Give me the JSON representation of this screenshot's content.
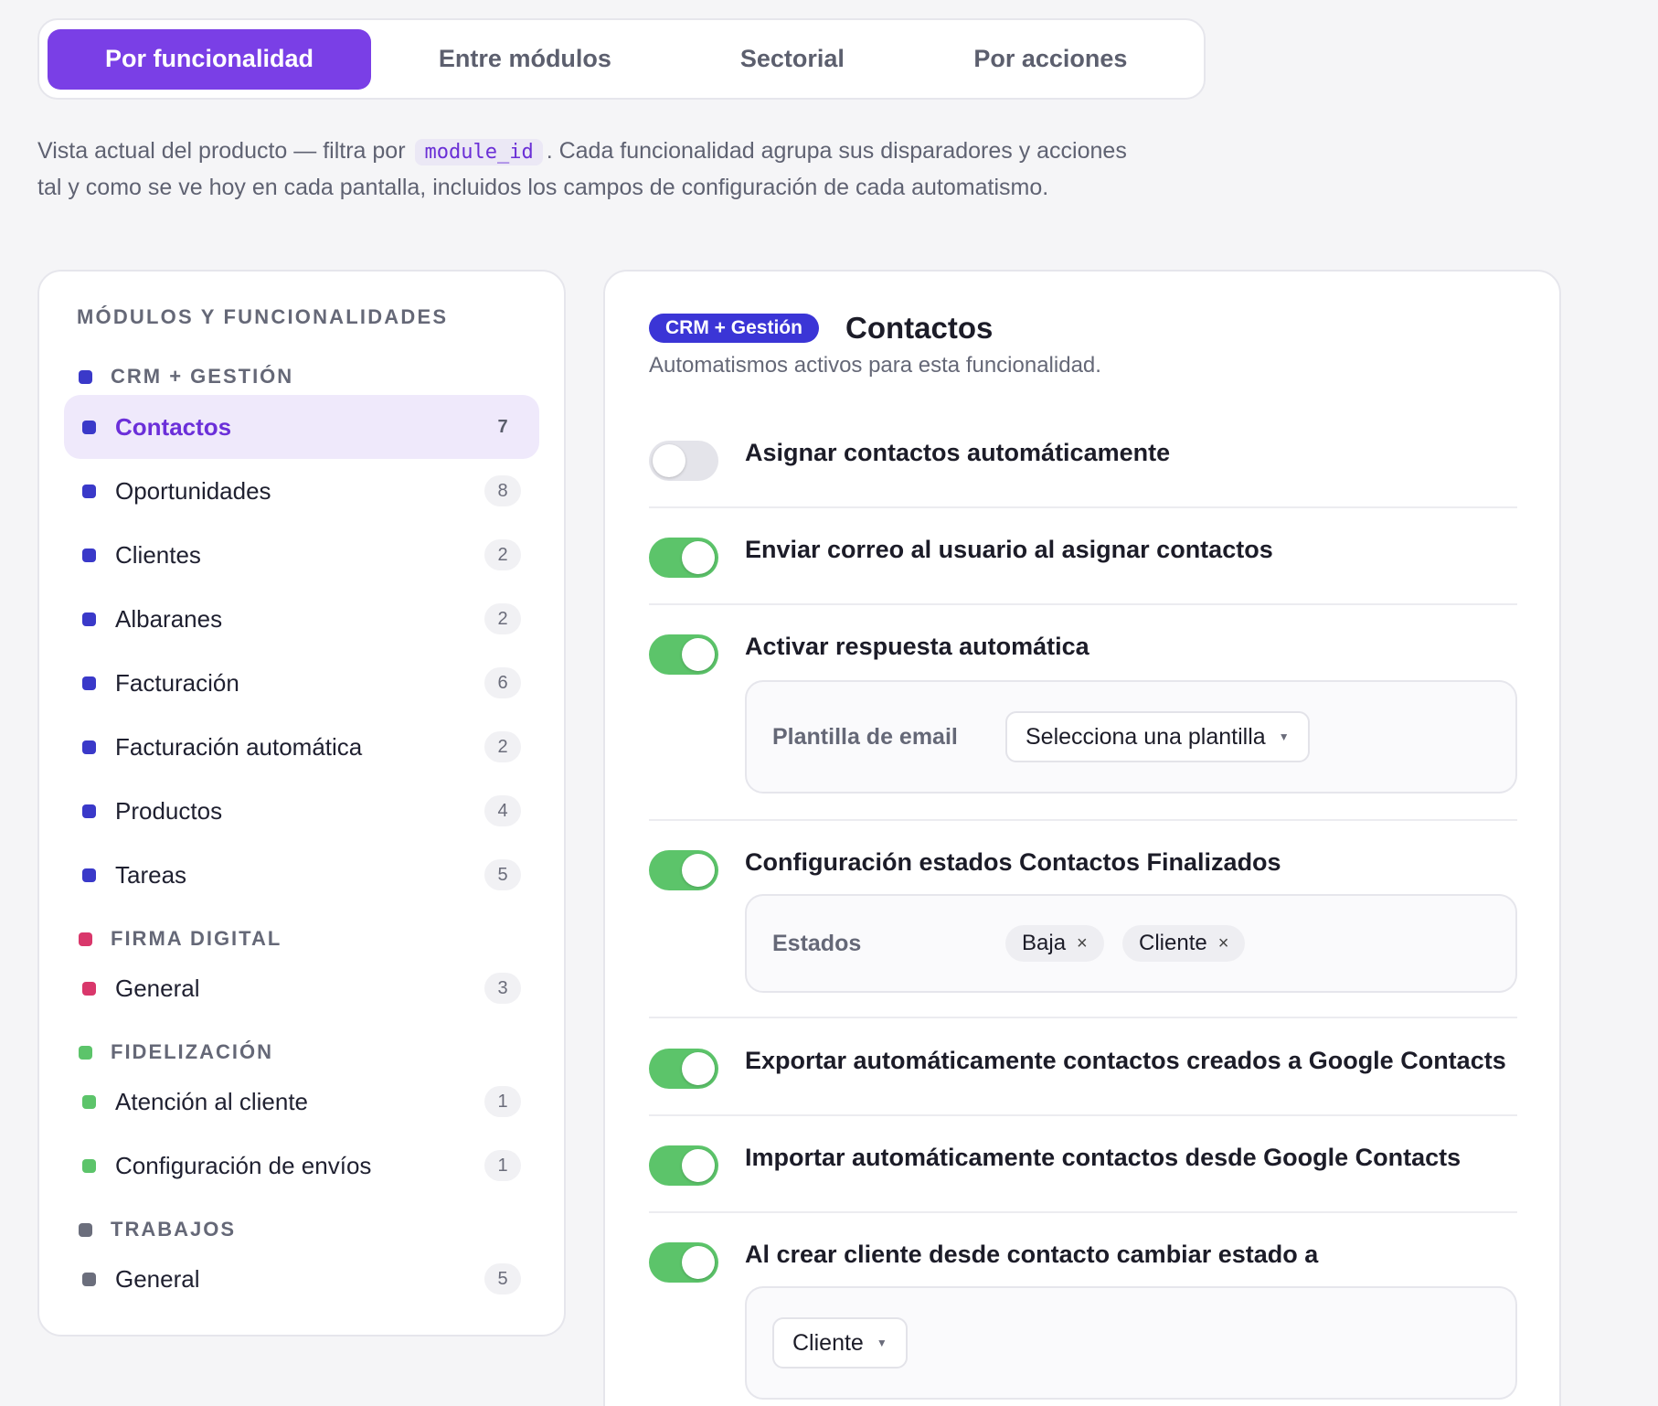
{
  "tabs": [
    {
      "label": "Por funcionalidad"
    },
    {
      "label": "Entre módulos"
    },
    {
      "label": "Sectorial"
    },
    {
      "label": "Por acciones"
    }
  ],
  "description": {
    "before": "Vista actual del producto — filtra por",
    "code": "module_id",
    "after": ". Cada funcionalidad agrupa sus disparadores y acciones tal y como se ve hoy en cada pantalla, incluidos los campos de configuración de cada automatismo."
  },
  "sidebar": {
    "title": "MÓDULOS Y FUNCIONALIDADES",
    "groups": [
      {
        "name": "CRM + GESTIÓN",
        "color": "#3a39c9"
      },
      {
        "name": "FIRMA DIGITAL",
        "color": "#d9376b"
      },
      {
        "name": "FIDELIZACIÓN",
        "color": "#5cc46a"
      },
      {
        "name": "TRABAJOS",
        "color": "#6b6e7c"
      }
    ],
    "items": [
      {
        "label": "Contactos",
        "count": "7"
      },
      {
        "label": "Oportunidades",
        "count": "8"
      },
      {
        "label": "Clientes",
        "count": "2"
      },
      {
        "label": "Albaranes",
        "count": "2"
      },
      {
        "label": "Facturación",
        "count": "6"
      },
      {
        "label": "Facturación automática",
        "count": "2"
      },
      {
        "label": "Productos",
        "count": "4"
      },
      {
        "label": "Tareas",
        "count": "5"
      },
      {
        "label": "General",
        "count": "3"
      },
      {
        "label": "Atención al cliente",
        "count": "1"
      },
      {
        "label": "Configuración de envíos",
        "count": "1"
      },
      {
        "label": "General",
        "count": "5"
      }
    ]
  },
  "panel": {
    "badge": "CRM + Gestión",
    "title": "Contactos",
    "subtitle": "Automatismos activos para esta funcionalidad.",
    "automations": [
      {
        "title": "Asignar contactos automáticamente",
        "enabled": false
      },
      {
        "title": "Enviar correo al usuario al asignar contactos",
        "enabled": true
      },
      {
        "title": "Activar respuesta automática",
        "enabled": true,
        "config": {
          "label": "Plantilla de email",
          "select": "Selecciona una plantilla"
        }
      },
      {
        "title": "Configuración estados Contactos Finalizados",
        "enabled": true,
        "config": {
          "label": "Estados",
          "chips": [
            "Baja",
            "Cliente"
          ]
        }
      },
      {
        "title": "Exportar automáticamente contactos creados a Google Contacts",
        "enabled": true
      },
      {
        "title": "Importar automáticamente contactos desde Google Contacts",
        "enabled": true
      },
      {
        "title": "Al crear cliente desde contacto cambiar estado a",
        "enabled": true,
        "config": {
          "select": "Cliente"
        }
      }
    ]
  },
  "icons": {
    "caret": "caret-down-icon",
    "remove": "close-icon"
  },
  "colors": {
    "accent": "#7a3fe6",
    "badge": "#3b35d6",
    "toggle_on": "#5cc46a",
    "toggle_off": "#e4e4ea"
  }
}
